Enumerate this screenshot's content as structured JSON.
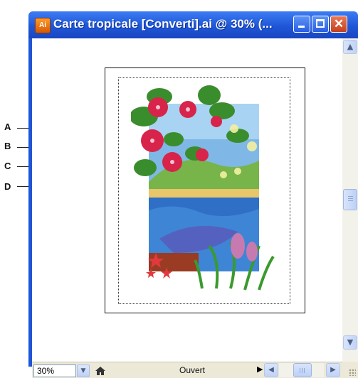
{
  "window": {
    "title": "Carte tropicale [Converti].ai @ 30% (...",
    "app_icon_text": "Ai",
    "close_glyph": "✕"
  },
  "callouts": [
    "A",
    "B",
    "C",
    "D"
  ],
  "statusbar": {
    "zoom_value": "30%",
    "status_text": "Ouvert",
    "status_arrow": "▶"
  },
  "icons": {
    "app": "illustrator-icon",
    "minimize": "minimize-icon",
    "maximize": "maximize-icon",
    "close": "close-icon",
    "scroll_up": "chevron-up-icon",
    "scroll_down": "chevron-down-icon",
    "zoom_drop": "chevron-down-icon",
    "home": "home-icon",
    "left": "chevron-left-icon",
    "right": "chevron-right-icon"
  },
  "colors": {
    "titlebar": "#1f56d8",
    "close_button": "#c4401c",
    "chrome": "#ece9d8"
  }
}
